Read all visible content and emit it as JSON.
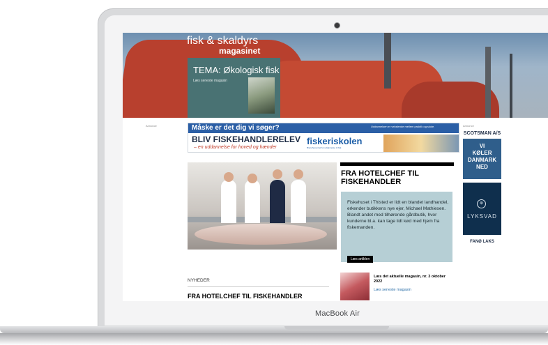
{
  "device": {
    "brand": "MacBook Air"
  },
  "site": {
    "logo_line1": "fisk & skaldyrs",
    "logo_line2": "magasinet",
    "tema_title": "TEMA: Økologisk fisk",
    "tema_link": "Læs seneste magasin"
  },
  "ads": {
    "label_left": "Annonce",
    "label_right": "Annonce",
    "banner_question": "Måske er det dig vi søger?",
    "banner_headline": "BLIV FISKEHANDLERELEV",
    "banner_script": "– en uddannelse for hoved og hænder",
    "banner_brand": "fiskeriskolen",
    "banner_brand_sub": "Branchecentret for uddannelse til fisk",
    "banner_note": "Uddannelsen er vekslende mellem praktik og skole.",
    "scotsman": "SCOTSMAN A/S",
    "koler_line1": "VI",
    "koler_line2": "KØLER",
    "koler_line3": "DANMARK",
    "koler_line4": "NED",
    "lyksvad_mark": "⊗",
    "lyksvad_name": "LYKSVAD",
    "fanoe": "FANØ LAKS"
  },
  "article": {
    "title": "FRA HOTELCHEF TIL FISKEHANDLER",
    "body": "Fiskehuset i Thisted er lidt en blandet landhandel, erkender butikkens nye ejer, Michael Mathiesen. Blandt andet med tilhørende gårdbutik, hvor kunderne bl.a. kan tage lidt kød med hjem fra fiskemanden.",
    "button": "Læs artiklen"
  },
  "magazine": {
    "title": "Læs det aktuelle magasin, nr. 3 oktober 2022",
    "link": "Læs seneste magasin"
  },
  "news": {
    "label": "NYHEDER",
    "headline": "FRA HOTELCHEF TIL FISKEHANDLER"
  }
}
